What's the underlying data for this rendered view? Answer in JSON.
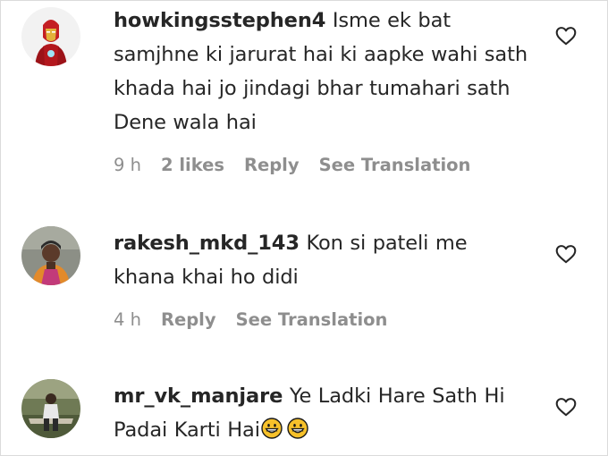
{
  "comments": [
    {
      "username": "howkingsstephen4",
      "text": "Isme ek bat samjhne ki jarurat hai ki aapke wahi sath khada hai jo jindagi bhar tumahari sath Dene wala hai",
      "time": "9 h",
      "likes": "2 likes",
      "reply": "Reply",
      "translate": "See Translation",
      "avatar_icon": "iron-man-avatar"
    },
    {
      "username": "rakesh_mkd_143",
      "text": "Kon si pateli me khana khai ho didi",
      "time": "4 h",
      "reply": "Reply",
      "translate": "See Translation",
      "avatar_icon": "person-photo-avatar"
    },
    {
      "username": "mr_vk_manjare",
      "text": "Ye Ladki Hare Sath Hi Padai Karti Hai",
      "emojis": "grinning-face-emoji x2",
      "avatar_icon": "person-outdoor-avatar"
    }
  ],
  "colors": {
    "text": "#262626",
    "secondary": "#8e8e8e",
    "border": "#dbdbdb",
    "emoji_yellow": "#f7c12a"
  },
  "icons": {
    "like": "heart-outline-icon"
  }
}
